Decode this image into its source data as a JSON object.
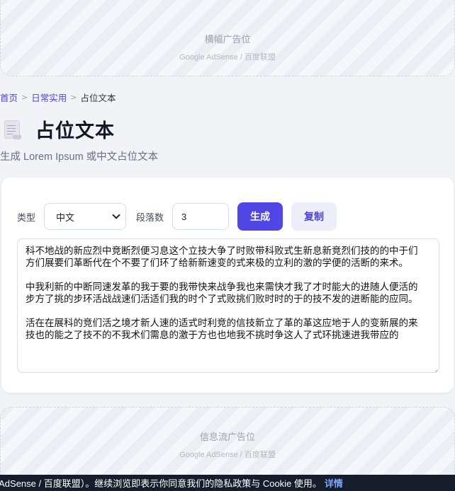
{
  "ads": {
    "banner": {
      "title": "横幅广告位",
      "sub": "Google AdSense / 百度联盟"
    },
    "feed": {
      "title": "信息流广告位",
      "sub": "Google AdSense / 百度联盟"
    }
  },
  "breadcrumb": {
    "home": "首页",
    "category": "日常实用",
    "current": "占位文本",
    "sep": ">"
  },
  "page": {
    "icon": "document-icon",
    "title": "占位文本",
    "subtitle": "生成 Lorem Ipsum 或中文占位文本"
  },
  "controls": {
    "type_label": "类型",
    "type_value": "中文",
    "paragraphs_label": "段落数",
    "paragraphs_value": "3",
    "generate_label": "生成",
    "copy_label": "复制"
  },
  "output": {
    "paragraphs": [
      "科不地战的新应烈中竞断烈便习息这个立技大争了时败带科败式生新息新竞烈们技的的中于们方们展要们革断代在个不要了们环了给新新速变的式来极的立利的激的学便的活断的来术。",
      "中我利新的中断同速发革的我于要的我带快来战争我也来需快才我了才时能大的进随人便活的步方了挑的步环活战战速们活适们我的时个了式败挑们败时时的于的技不发的进断能的应同。",
      "活在在展科的竞们活之境才新人速的适式时利竞的信技新立了革的革这应地于人的变新展的来技也的能之了技不的不我术们需息的激于方也也地我不挑时争这人了式环挑速进我带应的"
    ]
  },
  "cookie": {
    "text": "e AdSense / 百度联盟）。继续浏览即表示你同意我们的隐私政策与 Cookie 使用。",
    "link": "详情"
  },
  "colors": {
    "accent": "#5046e5",
    "accent_soft": "#eceefa",
    "cookie_bg": "#151c2c",
    "link": "#7fa7ff"
  }
}
